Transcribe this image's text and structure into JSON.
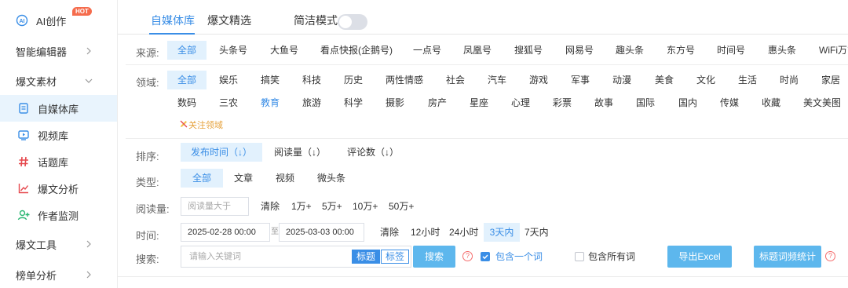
{
  "sidebar": {
    "ai_label": "AI创作",
    "hot_badge": "HOT",
    "items": [
      {
        "label": "智能编辑器"
      },
      {
        "label": "爆文素材"
      },
      {
        "label": "自媒体库"
      },
      {
        "label": "视频库"
      },
      {
        "label": "话题库"
      },
      {
        "label": "爆文分析"
      },
      {
        "label": "作者监测"
      },
      {
        "label": "爆文工具"
      },
      {
        "label": "榜单分析"
      }
    ]
  },
  "tabs": {
    "items": [
      "自媒体库",
      "爆文精选"
    ],
    "active": "自媒体库",
    "compact_mode_label": "简洁模式",
    "compact_mode_on": false
  },
  "source": {
    "label": "来源:",
    "options": [
      "全部",
      "头条号",
      "大鱼号",
      "看点快报(企鹅号)",
      "一点号",
      "凤凰号",
      "搜狐号",
      "网易号",
      "趣头条",
      "东方号",
      "时间号",
      "惠头条",
      "WiFi万能"
    ],
    "selected": "全部"
  },
  "domain": {
    "label": "领域:",
    "row1": [
      "全部",
      "娱乐",
      "搞笑",
      "科技",
      "历史",
      "两性情感",
      "社会",
      "汽车",
      "游戏",
      "军事",
      "动漫",
      "美食",
      "文化",
      "生活",
      "时尚",
      "家居"
    ],
    "row2": [
      "数码",
      "三农",
      "教育",
      "旅游",
      "科学",
      "摄影",
      "房产",
      "星座",
      "心理",
      "彩票",
      "故事",
      "国际",
      "国内",
      "传媒",
      "收藏",
      "美文美图"
    ],
    "selected": "全部",
    "highlighted": "教育",
    "follow_label": "关注领域"
  },
  "sort": {
    "label": "排序:",
    "options": [
      "发布时间（↓）",
      "阅读量（↓）",
      "评论数（↓）"
    ],
    "selected": "发布时间（↓）"
  },
  "type": {
    "label": "类型:",
    "options": [
      "全部",
      "文章",
      "视频",
      "微头条"
    ],
    "selected": "全部"
  },
  "reads": {
    "label": "阅读量:",
    "placeholder": "阅读量大于",
    "clear_label": "清除",
    "options": [
      "1万+",
      "5万+",
      "10万+",
      "50万+"
    ]
  },
  "time": {
    "label": "时间:",
    "start": "2025-02-28 00:00",
    "separator": "至",
    "end": "2025-03-03 00:00",
    "clear_label": "清除",
    "options": [
      "12小时",
      "24小时",
      "3天内",
      "7天内"
    ],
    "selected": "3天内"
  },
  "search": {
    "label": "搜索:",
    "placeholder": "请输入关键词",
    "mode_options": [
      "标题",
      "标签"
    ],
    "mode_selected": "标题",
    "search_button": "搜索",
    "help": "?",
    "include_any_label": "包含一个词",
    "include_any_checked": true,
    "include_all_label": "包含所有词",
    "include_all_checked": false,
    "export_button": "导出Excel",
    "stats_button": "标题词频统计"
  },
  "colors": {
    "accent": "#3a8ee6",
    "selected_bg": "#e2f1fd",
    "button": "#5db7ed",
    "hot": "#f56c4d",
    "help": "#f56c6c"
  }
}
